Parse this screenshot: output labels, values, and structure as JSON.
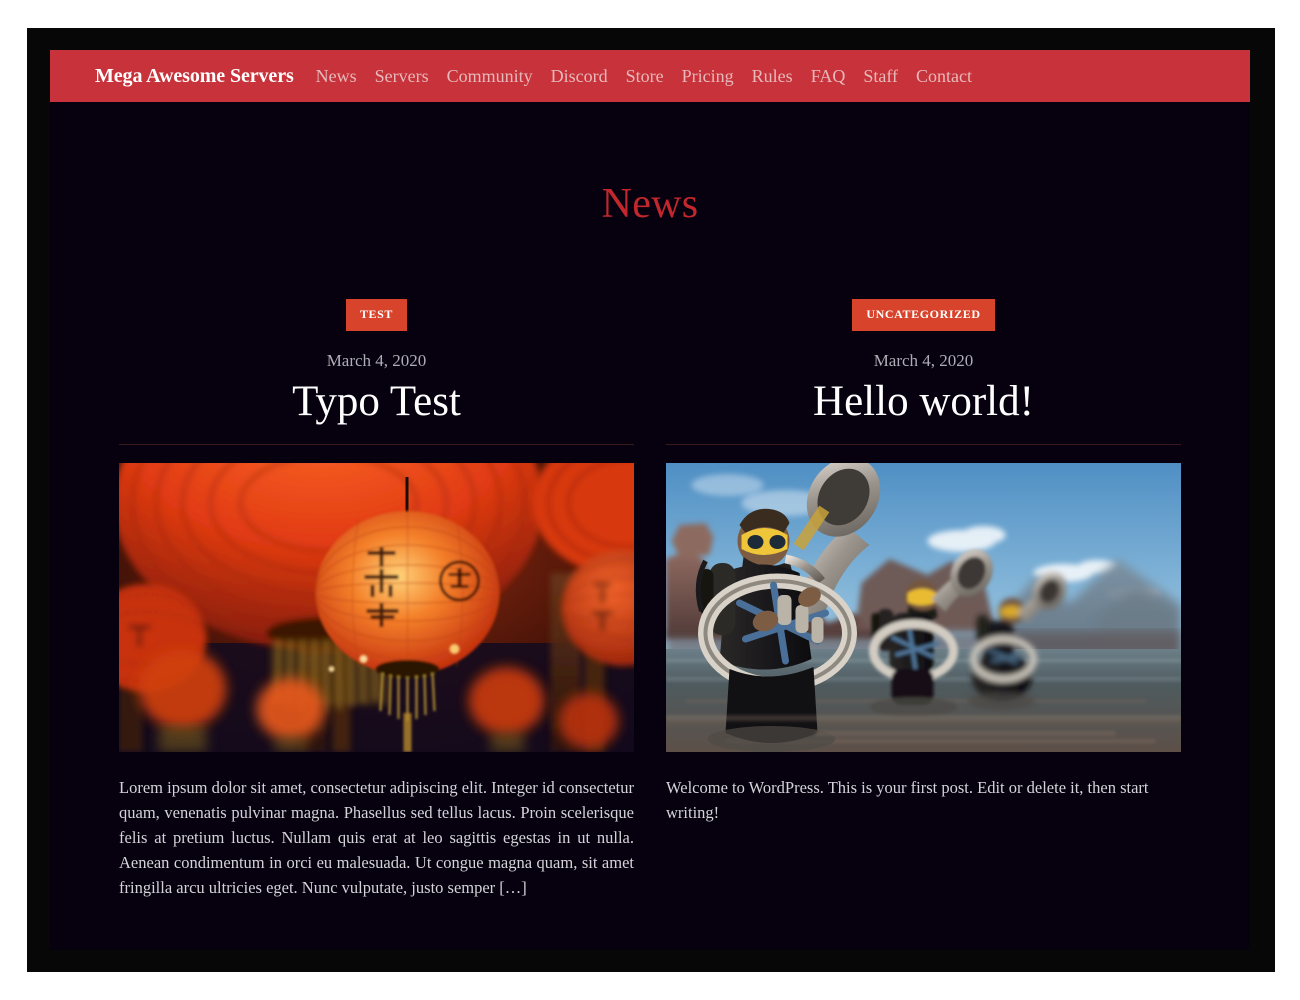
{
  "header": {
    "brand": "Mega Awesome Servers",
    "accent_color": "#c8323a",
    "nav": [
      {
        "label": "News"
      },
      {
        "label": "Servers"
      },
      {
        "label": "Community"
      },
      {
        "label": "Discord"
      },
      {
        "label": "Store"
      },
      {
        "label": "Pricing"
      },
      {
        "label": "Rules"
      },
      {
        "label": "FAQ"
      },
      {
        "label": "Staff"
      },
      {
        "label": "Contact"
      }
    ]
  },
  "main": {
    "page_title": "News",
    "title_color": "#c1272d",
    "badge_color": "#d8432c",
    "posts": [
      {
        "category": "TEST",
        "date": "March 4, 2020",
        "title": "Typo Test",
        "image_name": "red-paper-lanterns-photo",
        "excerpt": "Lorem ipsum dolor sit amet, consectetur adipiscing elit. Integer id consectetur quam, venenatis pulvinar magna. Phasellus sed tellus lacus. Proin scelerisque felis at pretium luctus. Nullam quis erat at leo sagittis egestas in ut nulla. Aenean condimentum in orci eu malesuada. Ut congue magna quam, sit amet fringilla arcu ultricies eget. Nunc vulputate, justo semper […]"
      },
      {
        "category": "UNCATEGORIZED",
        "date": "March 4, 2020",
        "title": "Hello world!",
        "image_name": "scuba-divers-sousaphones-photo",
        "excerpt": "Welcome to WordPress. This is your first post. Edit or delete it, then start writing!"
      }
    ]
  }
}
